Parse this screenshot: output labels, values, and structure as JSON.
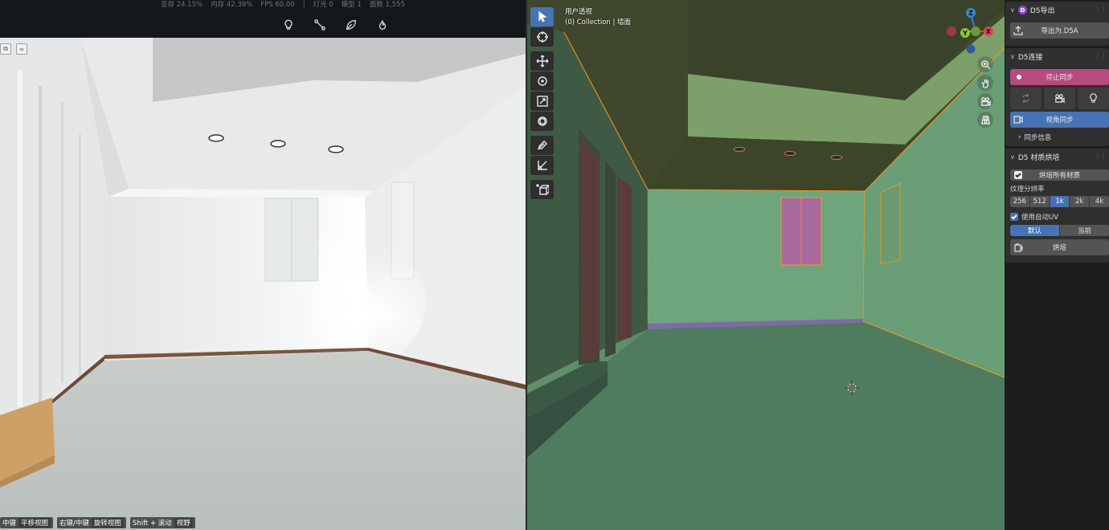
{
  "render": {
    "stats": {
      "vram": "显存 24.15%",
      "mem": "内存 42.39%",
      "fps": "FPS 60.00",
      "sep": "|",
      "lights": "灯光 0",
      "models": "模型 1",
      "faces": "面数 1,555"
    },
    "tools": [
      "bulb-icon",
      "path-icon",
      "leaf-icon",
      "flame-icon"
    ],
    "hints": [
      {
        "key": "中键",
        "action": "平移视图"
      },
      {
        "key": "右键/中键",
        "action": "旋转视图"
      },
      {
        "key": "Shift + 滚动",
        "action": "视野"
      }
    ]
  },
  "viewport": {
    "view_name": "用户透视",
    "collection": "(0) Collection | 墙面",
    "gizmo": {
      "z": "Z",
      "y": "Y",
      "x": "X"
    },
    "colors": {
      "x_axis": "#e2444f",
      "y_axis": "#8bc33c",
      "z_axis": "#3d83d9",
      "selection": "#f29a24",
      "wall": "#6b9c75",
      "ceiling": "#3e472c"
    }
  },
  "npanel": {
    "export": {
      "title": "D5导出",
      "badge": "D",
      "export_button": "导出为.D5A"
    },
    "link": {
      "title": "D5连接",
      "stop_sync": "停止同步",
      "view_sync": "视角同步",
      "sync_info": "同步信息"
    },
    "bake": {
      "title": "D5 材质烘培",
      "bake_all": "烘培所有材质",
      "texture_label": "纹理分辨率",
      "resolutions": [
        "256",
        "512",
        "1k",
        "2k",
        "4k"
      ],
      "selected_resolution": "1k",
      "auto_uv": "使用自动UV",
      "mode_default": "默认",
      "mode_current": "当前",
      "bake_button": "烘培"
    }
  }
}
